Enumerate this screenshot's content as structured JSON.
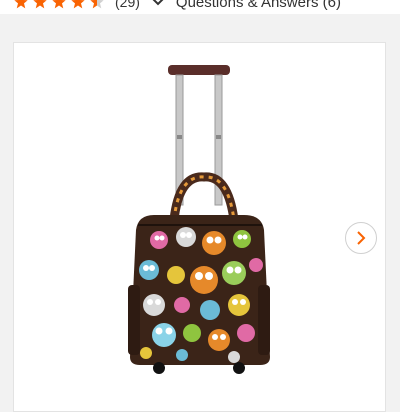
{
  "rating": {
    "stars_filled": 4.5,
    "stars_total": 5,
    "count_text": "(29)",
    "star_color": "#f96302"
  },
  "qa": {
    "label": "Questions & Answers (6)"
  },
  "gallery": {
    "image_alt": "Owl print rolling underseat tote luggage"
  },
  "icons": {
    "expand": "chevron-down-icon",
    "next": "chevron-right-icon"
  },
  "colors": {
    "accent": "#f96302",
    "bag_base": "#3b2418",
    "handle": "#b9b9b9"
  }
}
